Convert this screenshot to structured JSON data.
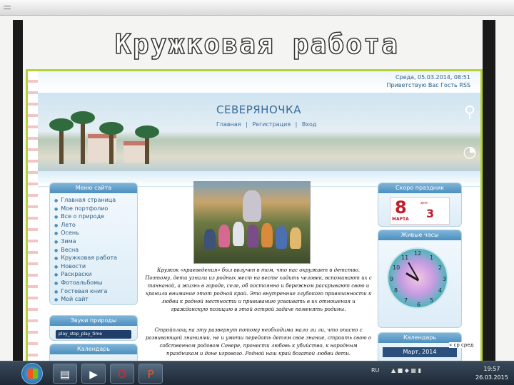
{
  "slide": {
    "title": "Кружковая работа"
  },
  "site": {
    "name": "СЕВЕРЯНОЧКА",
    "date_line": "Среда, 05.03.2014, 08:51",
    "greeting": "Приветствую Вас Гость",
    "greeting_link": "RSS",
    "nav": [
      "Главная",
      "|",
      "Регистрация",
      "|",
      "Вход"
    ]
  },
  "left_menu": {
    "title": "Меню сайта",
    "items": [
      "Главная страница",
      "Мое портфолио",
      "Все о природе",
      "Лето",
      "Осень",
      "Зима",
      "Весна",
      "Кружковая работа",
      "Новости",
      "Раскраски",
      "Фотоальбомы",
      "Гостевая книга",
      "Мой сайт"
    ]
  },
  "nature_sounds": {
    "title": "Звуки природы",
    "player_text": "play_stop_play_time"
  },
  "left_bottom": {
    "title": "Календарь"
  },
  "right_holiday": {
    "title": "Скоро праздник",
    "card_8": "8",
    "card_march": "МАРТА",
    "card_3": "3",
    "card_days": "дня"
  },
  "right_clock": {
    "title": "Живые часы",
    "numbers": [
      "12",
      "1",
      "2",
      "3",
      "4",
      "5",
      "6",
      "7",
      "8",
      "9",
      "10",
      "11"
    ]
  },
  "right_calendar": {
    "title": "Календарь",
    "month": "Март, 2014",
    "side_note": "« ср сред"
  },
  "content": {
    "para1": "Кружок «краеведения» был ввлучен в том, что нас окружает в детство. Поэтому, дети узнали из родных мест на весте ходить человек, вспоминают их с таннаной, а жизнь в городе, селе, об постоянно и бережном раскрывают свою и хранили внимание этот родной край. Это внутренние глубокого привязанности к любви к родной местности и прививанию усваивать в их отношения и гражданскую позицию в этой острой задаче поменять родины.",
    "para2": "Стройплощ на эту развернут потому необходима мало ли ли, что опасно с развивающей знаниями, не и умети передать детям свое знание, строить свою о собственном родовом Севере, пронести любовь к убийство, к народным праздникам и доне игрового. Родной наш край богатой любви дети."
  },
  "taskbar": {
    "buttons": [
      "windows-explorer",
      "media-player",
      "opera",
      "powerpoint"
    ],
    "tray_lang": "RU",
    "time": "19:57",
    "date": "26.03.2015"
  }
}
